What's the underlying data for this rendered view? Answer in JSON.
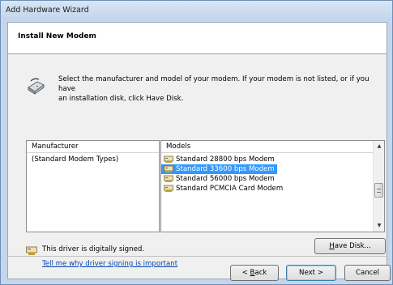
{
  "window": {
    "title": "Add Hardware Wizard"
  },
  "header": {
    "title": "Install New Modem"
  },
  "intro": {
    "line1": "Select the manufacturer and model of your modem. If your modem is not listed, or if you have",
    "line2": "an installation disk, click Have Disk.",
    "icon": "modem-icon"
  },
  "manufacturer": {
    "header": "Manufacturer",
    "items": [
      "(Standard Modem Types)"
    ]
  },
  "models": {
    "header": "Models",
    "items": [
      "Standard 28800 bps Modem",
      "Standard 33600 bps Modem",
      "Standard 56000 bps Modem",
      "Standard PCMCIA Card Modem"
    ],
    "selected_index": 1
  },
  "driver": {
    "signed_text": "This driver is digitally signed.",
    "link_text": "Tell me why driver signing is important"
  },
  "buttons": {
    "have_disk_prefix": "",
    "have_disk_mnemonic": "H",
    "have_disk_rest": "ave Disk...",
    "back_prefix": "< ",
    "back_mnemonic": "B",
    "back_rest": "ack",
    "next": "Next >",
    "cancel": "Cancel"
  },
  "colors": {
    "selection": "#3399ff",
    "link": "#0645ad"
  }
}
